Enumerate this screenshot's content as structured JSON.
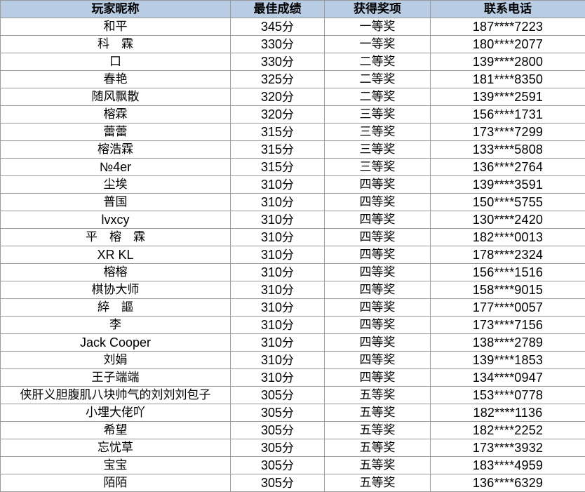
{
  "sheet": {
    "headers": {
      "nickname": "玩家昵称",
      "score": "最佳成绩",
      "prize": "获得奖项",
      "phone": "联系电话"
    },
    "header_bg": "#b8cce4",
    "grid_color": "#9a9a9a",
    "rows": [
      {
        "nickname": "和平",
        "score": "345",
        "unit": "分",
        "prize": "一等奖",
        "phone": "187****7223"
      },
      {
        "nickname": "科　霖",
        "score": "330",
        "unit": "分",
        "prize": "一等奖",
        "phone": "180****2077"
      },
      {
        "nickname": "口",
        "score": "330",
        "unit": "分",
        "prize": "二等奖",
        "phone": "139****2800"
      },
      {
        "nickname": "春艳",
        "score": "325",
        "unit": "分",
        "prize": "二等奖",
        "phone": "181****8350"
      },
      {
        "nickname": "随风飘散",
        "score": "320",
        "unit": "分",
        "prize": "二等奖",
        "phone": "139****2591"
      },
      {
        "nickname": "榕霖",
        "score": "320",
        "unit": "分",
        "prize": "三等奖",
        "phone": "156****1731"
      },
      {
        "nickname": "蕾蕾",
        "score": "315",
        "unit": "分",
        "prize": "三等奖",
        "phone": "173****7299"
      },
      {
        "nickname": "榕浩霖",
        "score": "315",
        "unit": "分",
        "prize": "三等奖",
        "phone": "133****5808"
      },
      {
        "nickname": "№4er",
        "score": "315",
        "unit": "分",
        "prize": "三等奖",
        "phone": "136****2764"
      },
      {
        "nickname": "尘埃",
        "score": "310",
        "unit": "分",
        "prize": "四等奖",
        "phone": "139****3591"
      },
      {
        "nickname": "普国",
        "score": "310",
        "unit": "分",
        "prize": "四等奖",
        "phone": "150****5755"
      },
      {
        "nickname": "lvxcy",
        "score": "310",
        "unit": "分",
        "prize": "四等奖",
        "phone": "130****2420"
      },
      {
        "nickname": "平　榕　霖",
        "score": "310",
        "unit": "分",
        "prize": "四等奖",
        "phone": "182****0013"
      },
      {
        "nickname": "XR KL",
        "score": "310",
        "unit": "分",
        "prize": "四等奖",
        "phone": "178****2324"
      },
      {
        "nickname": "榕榕",
        "score": "310",
        "unit": "分",
        "prize": "四等奖",
        "phone": "156****1516"
      },
      {
        "nickname": "棋协大师",
        "score": "310",
        "unit": "分",
        "prize": "四等奖",
        "phone": "158****9015"
      },
      {
        "nickname": "綷　謳",
        "score": "310",
        "unit": "分",
        "prize": "四等奖",
        "phone": "177****0057"
      },
      {
        "nickname": "李",
        "score": "310",
        "unit": "分",
        "prize": "四等奖",
        "phone": "173****7156"
      },
      {
        "nickname": "Jack Cooper",
        "score": "310",
        "unit": "分",
        "prize": "四等奖",
        "phone": "138****2789"
      },
      {
        "nickname": "刘娟",
        "score": "310",
        "unit": "分",
        "prize": "四等奖",
        "phone": "139****1853"
      },
      {
        "nickname": "王子端端",
        "score": "310",
        "unit": "分",
        "prize": "四等奖",
        "phone": "134****0947"
      },
      {
        "nickname": "侠肝义胆腹肌八块帅气的刘刘刘包子",
        "score": "305",
        "unit": "分",
        "prize": "五等奖",
        "phone": "153****0778"
      },
      {
        "nickname": "小埋大佬吖",
        "score": "305",
        "unit": "分",
        "prize": "五等奖",
        "phone": "182****1136"
      },
      {
        "nickname": "希望",
        "score": "305",
        "unit": "分",
        "prize": "五等奖",
        "phone": "182****2252"
      },
      {
        "nickname": "忘忧草",
        "score": "305",
        "unit": "分",
        "prize": "五等奖",
        "phone": "173****3932"
      },
      {
        "nickname": "宝宝",
        "score": "305",
        "unit": "分",
        "prize": "五等奖",
        "phone": "183****4959"
      },
      {
        "nickname": "陌陌",
        "score": "305",
        "unit": "分",
        "prize": "五等奖",
        "phone": "136****6329"
      }
    ]
  }
}
